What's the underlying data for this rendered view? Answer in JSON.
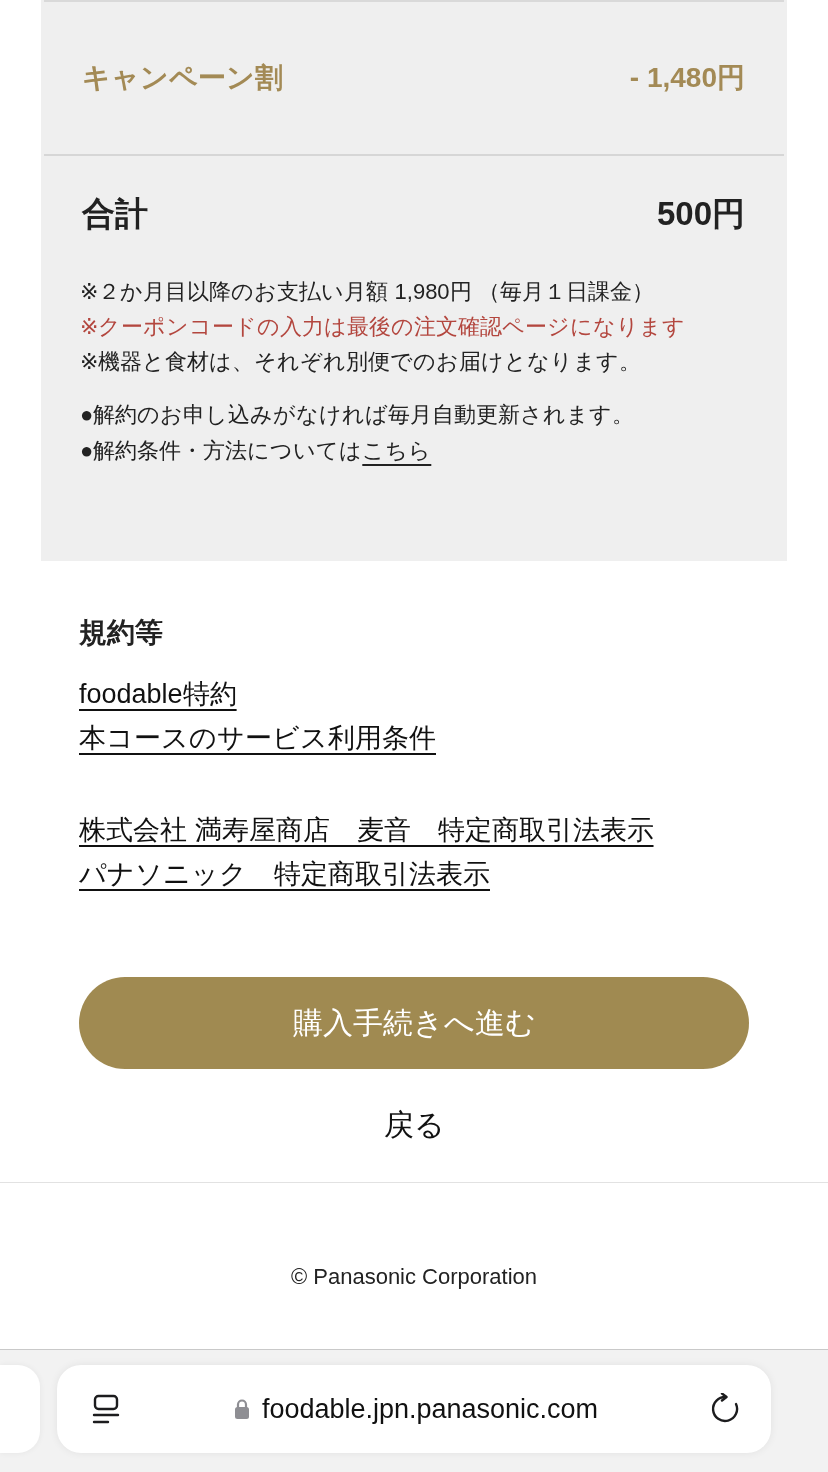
{
  "summary": {
    "discount": {
      "label": "キャンペーン割",
      "amount": "- 1,480円"
    },
    "total": {
      "label": "合計",
      "amount": "500円"
    },
    "notes": [
      {
        "kind": "normal",
        "text": "※２か月目以降のお支払い月額 1,980円 （毎月１日課金）"
      },
      {
        "kind": "alert",
        "text": "※クーポンコードの入力は最後の注文確認ページになります"
      },
      {
        "kind": "normal",
        "text": "※機器と食材は、それぞれ別便でのお届けとなります。"
      }
    ],
    "bullets": [
      {
        "text": "●解約のお申し込みがなければ毎月自動更新されます。"
      },
      {
        "text": "●解約条件・方法については",
        "link": "こちら"
      }
    ]
  },
  "terms": {
    "title": "規約等",
    "link_groups": [
      [
        "foodable特約",
        "本コースのサービス利用条件"
      ],
      [
        "株式会社 満寿屋商店　麦音　特定商取引法表示",
        "パナソニック　特定商取引法表示"
      ]
    ]
  },
  "primary_button": "購入手続きへ進む",
  "back_link": "戻る",
  "footer": {
    "copyright": "© Panasonic Corporation"
  },
  "browser_bar": {
    "url": "foodable.jpn.panasonic.com"
  }
}
